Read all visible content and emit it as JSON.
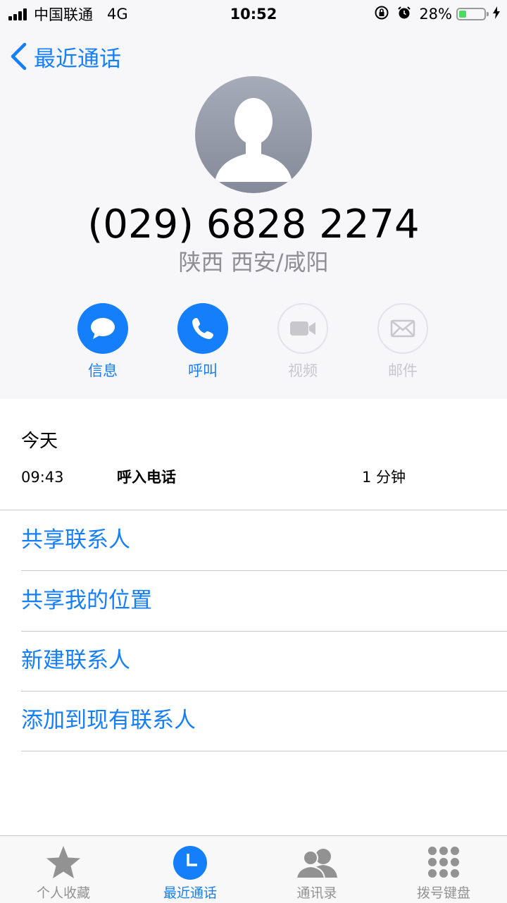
{
  "status_bar": {
    "carrier": "中国联通",
    "network": "4G",
    "time": "10:52",
    "battery_percent": "28%",
    "battery_level": 0.28
  },
  "nav": {
    "back_label": "最近通话"
  },
  "contact": {
    "phone_number": "(029) 6828 2274",
    "location": "陕西 西安/咸阳"
  },
  "actions": [
    {
      "label": "信息",
      "icon": "message-bubble-icon",
      "enabled": true
    },
    {
      "label": "呼叫",
      "icon": "phone-icon",
      "enabled": true
    },
    {
      "label": "视频",
      "icon": "video-camera-icon",
      "enabled": false
    },
    {
      "label": "邮件",
      "icon": "envelope-icon",
      "enabled": false
    }
  ],
  "recents": {
    "day_label": "今天",
    "calls": [
      {
        "time": "09:43",
        "type": "呼入电话",
        "duration": "1 分钟"
      }
    ]
  },
  "options": [
    {
      "label": "共享联系人"
    },
    {
      "label": "共享我的位置"
    },
    {
      "label": "新建联系人"
    },
    {
      "label": "添加到现有联系人"
    }
  ],
  "tab_bar": {
    "active_index": 1,
    "tabs": [
      {
        "label": "个人收藏",
        "icon": "star-icon"
      },
      {
        "label": "最近通话",
        "icon": "clock-icon"
      },
      {
        "label": "通讯录",
        "icon": "contacts-icon"
      },
      {
        "label": "拨号键盘",
        "icon": "keypad-icon"
      }
    ]
  },
  "colors": {
    "accent": "#157efb",
    "disabled": "#c7c7cc",
    "secondary_text": "#8e8e93",
    "battery_fill": "#4cd964"
  }
}
